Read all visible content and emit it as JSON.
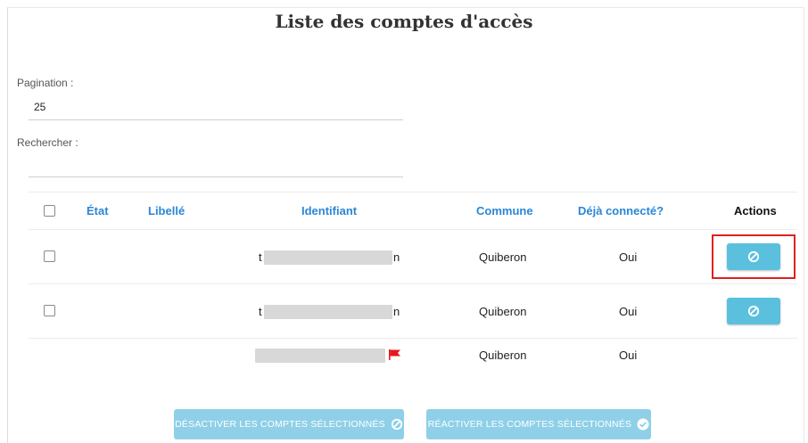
{
  "page": {
    "title": "Liste des comptes d'accès"
  },
  "pagination": {
    "label": "Pagination :",
    "value": "25"
  },
  "search": {
    "label": "Rechercher :",
    "value": ""
  },
  "table": {
    "headers": {
      "state": "État",
      "label": "Libellé",
      "identifier": "Identifiant",
      "commune": "Commune",
      "connected": "Déjà connecté?",
      "actions": "Actions"
    },
    "rows": [
      {
        "identifier_prefix": "t",
        "identifier_suffix": "n",
        "commune": "Quiberon",
        "connected": "Oui",
        "has_action": true,
        "selectable": true
      },
      {
        "identifier_prefix": "t",
        "identifier_suffix": "n",
        "commune": "Quiberon",
        "connected": "Oui",
        "has_action": true,
        "selectable": true
      },
      {
        "identifier_prefix": "",
        "identifier_suffix": "",
        "commune": "Quiberon",
        "connected": "Oui",
        "has_action": false,
        "selectable": false,
        "flag": "red-flag-icon"
      }
    ]
  },
  "bulk_actions": {
    "deactivate_label": "DÉSACTIVER LES COMPTES SÉLECTIONNÉS",
    "reactivate_label": "RÉACTIVER LES COMPTES SÉLECTIONNÉS"
  },
  "icons": {
    "row_action": "ban-icon",
    "deactivate": "ban-icon",
    "reactivate": "check-circle-icon",
    "flag": "red-flag-icon"
  },
  "colors": {
    "header_link": "#2b86d6",
    "action_button": "#5bc0de",
    "bulk_button": "#8fd0e8",
    "highlight": "#e02020",
    "flag": "#e8141e"
  }
}
